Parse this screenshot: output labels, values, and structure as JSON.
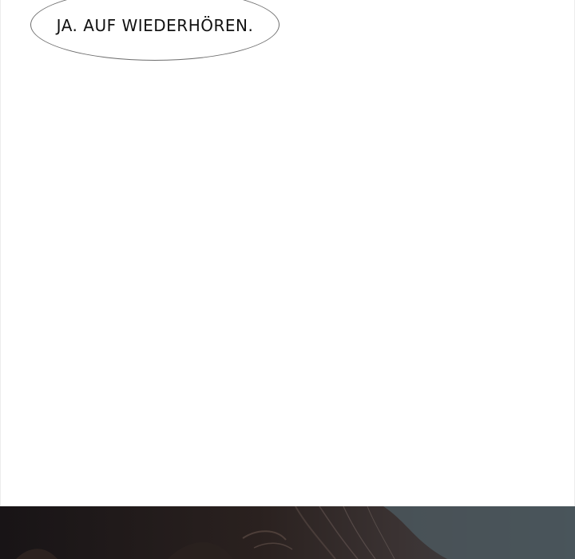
{
  "speech_bubble": {
    "text": "JA. AUF WIEDERHÖREN."
  },
  "colors": {
    "page_background": "#ffffff",
    "bubble_outline": "#6d6d6d",
    "text": "#111111",
    "dark_panel_left": "#1f1c1e",
    "dark_panel_right": "#4d5a60"
  }
}
